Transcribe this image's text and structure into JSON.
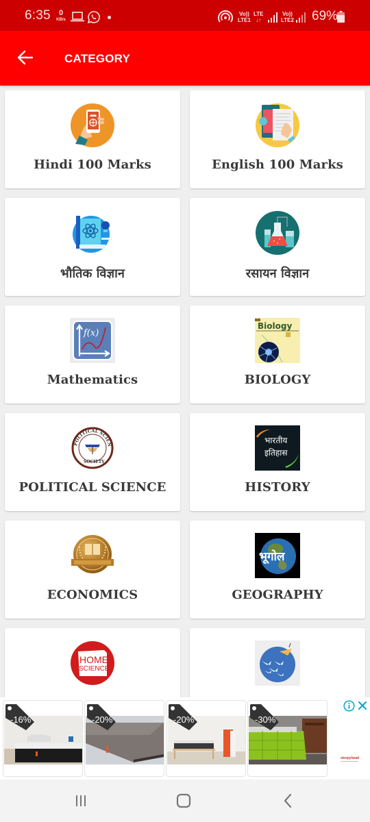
{
  "status_bar": {
    "time": "6:35",
    "net_speed_value": "0",
    "net_speed_unit": "KB/s",
    "notification_icons": [
      "laptop-icon",
      "whatsapp-icon",
      "dot-icon"
    ],
    "sim1_label_top": "Vo))",
    "sim1_label_bottom": "LTE1",
    "lte_label_top": "LTE",
    "lte_label_bottom": "↓↑",
    "sim2_label_top": "Vo))",
    "sim2_label_bottom": "LTE2",
    "battery": "69%",
    "colors": {
      "background": "#cc0000",
      "foreground": "#fce4e4"
    }
  },
  "app_bar": {
    "title": "CATEGORY",
    "back_icon": "arrow-left-icon",
    "color": "#ff0000"
  },
  "categories": [
    {
      "label": "Hindi 100 Marks",
      "icon": "hand-phone-icon"
    },
    {
      "label": "English 100 Marks",
      "icon": "tablet-document-icon"
    },
    {
      "label": "भौतिक विज्ञान",
      "icon": "physics-atom-icon"
    },
    {
      "label": "रसायन विज्ञान",
      "icon": "chemistry-flask-icon"
    },
    {
      "label": "Mathematics",
      "icon": "function-graph-icon",
      "icon_text": "f(x)"
    },
    {
      "label": "BIOLOGY",
      "icon": "biology-book-icon",
      "icon_text": "Biology"
    },
    {
      "label": "POLITICAL SCIENCE",
      "icon": "political-science-seal-icon",
      "icon_text": "POLITICAL SCIENCE SOCIETY"
    },
    {
      "label": "HISTORY",
      "icon": "indian-history-icon",
      "icon_text_1": "भारतीय",
      "icon_text_2": "इतिहास"
    },
    {
      "label": "ECONOMICS",
      "icon": "economics-medal-icon"
    },
    {
      "label": "GEOGRAPHY",
      "icon": "geography-globe-icon",
      "icon_text": "भूगोल"
    },
    {
      "label": "",
      "icon": "home-science-icon",
      "icon_text_1": "HOME",
      "icon_text_2": "SCIENCE"
    },
    {
      "label": "",
      "icon": "paper-boats-icon"
    }
  ],
  "ad": {
    "items": [
      {
        "discount": "-16%",
        "image": "mattress-with-pillow"
      },
      {
        "discount": "-20%",
        "image": "mattress-corner"
      },
      {
        "discount": "-20%",
        "image": "mattress-on-bed-frame"
      },
      {
        "discount": "-30%",
        "image": "green-comforter-bed"
      }
    ],
    "brand": "sleepyhead",
    "info_icon": "info-icon",
    "close_icon": "close-icon",
    "accent": "#00a6c8"
  },
  "nav_bar": {
    "buttons": [
      "recent-apps",
      "home",
      "back"
    ]
  }
}
